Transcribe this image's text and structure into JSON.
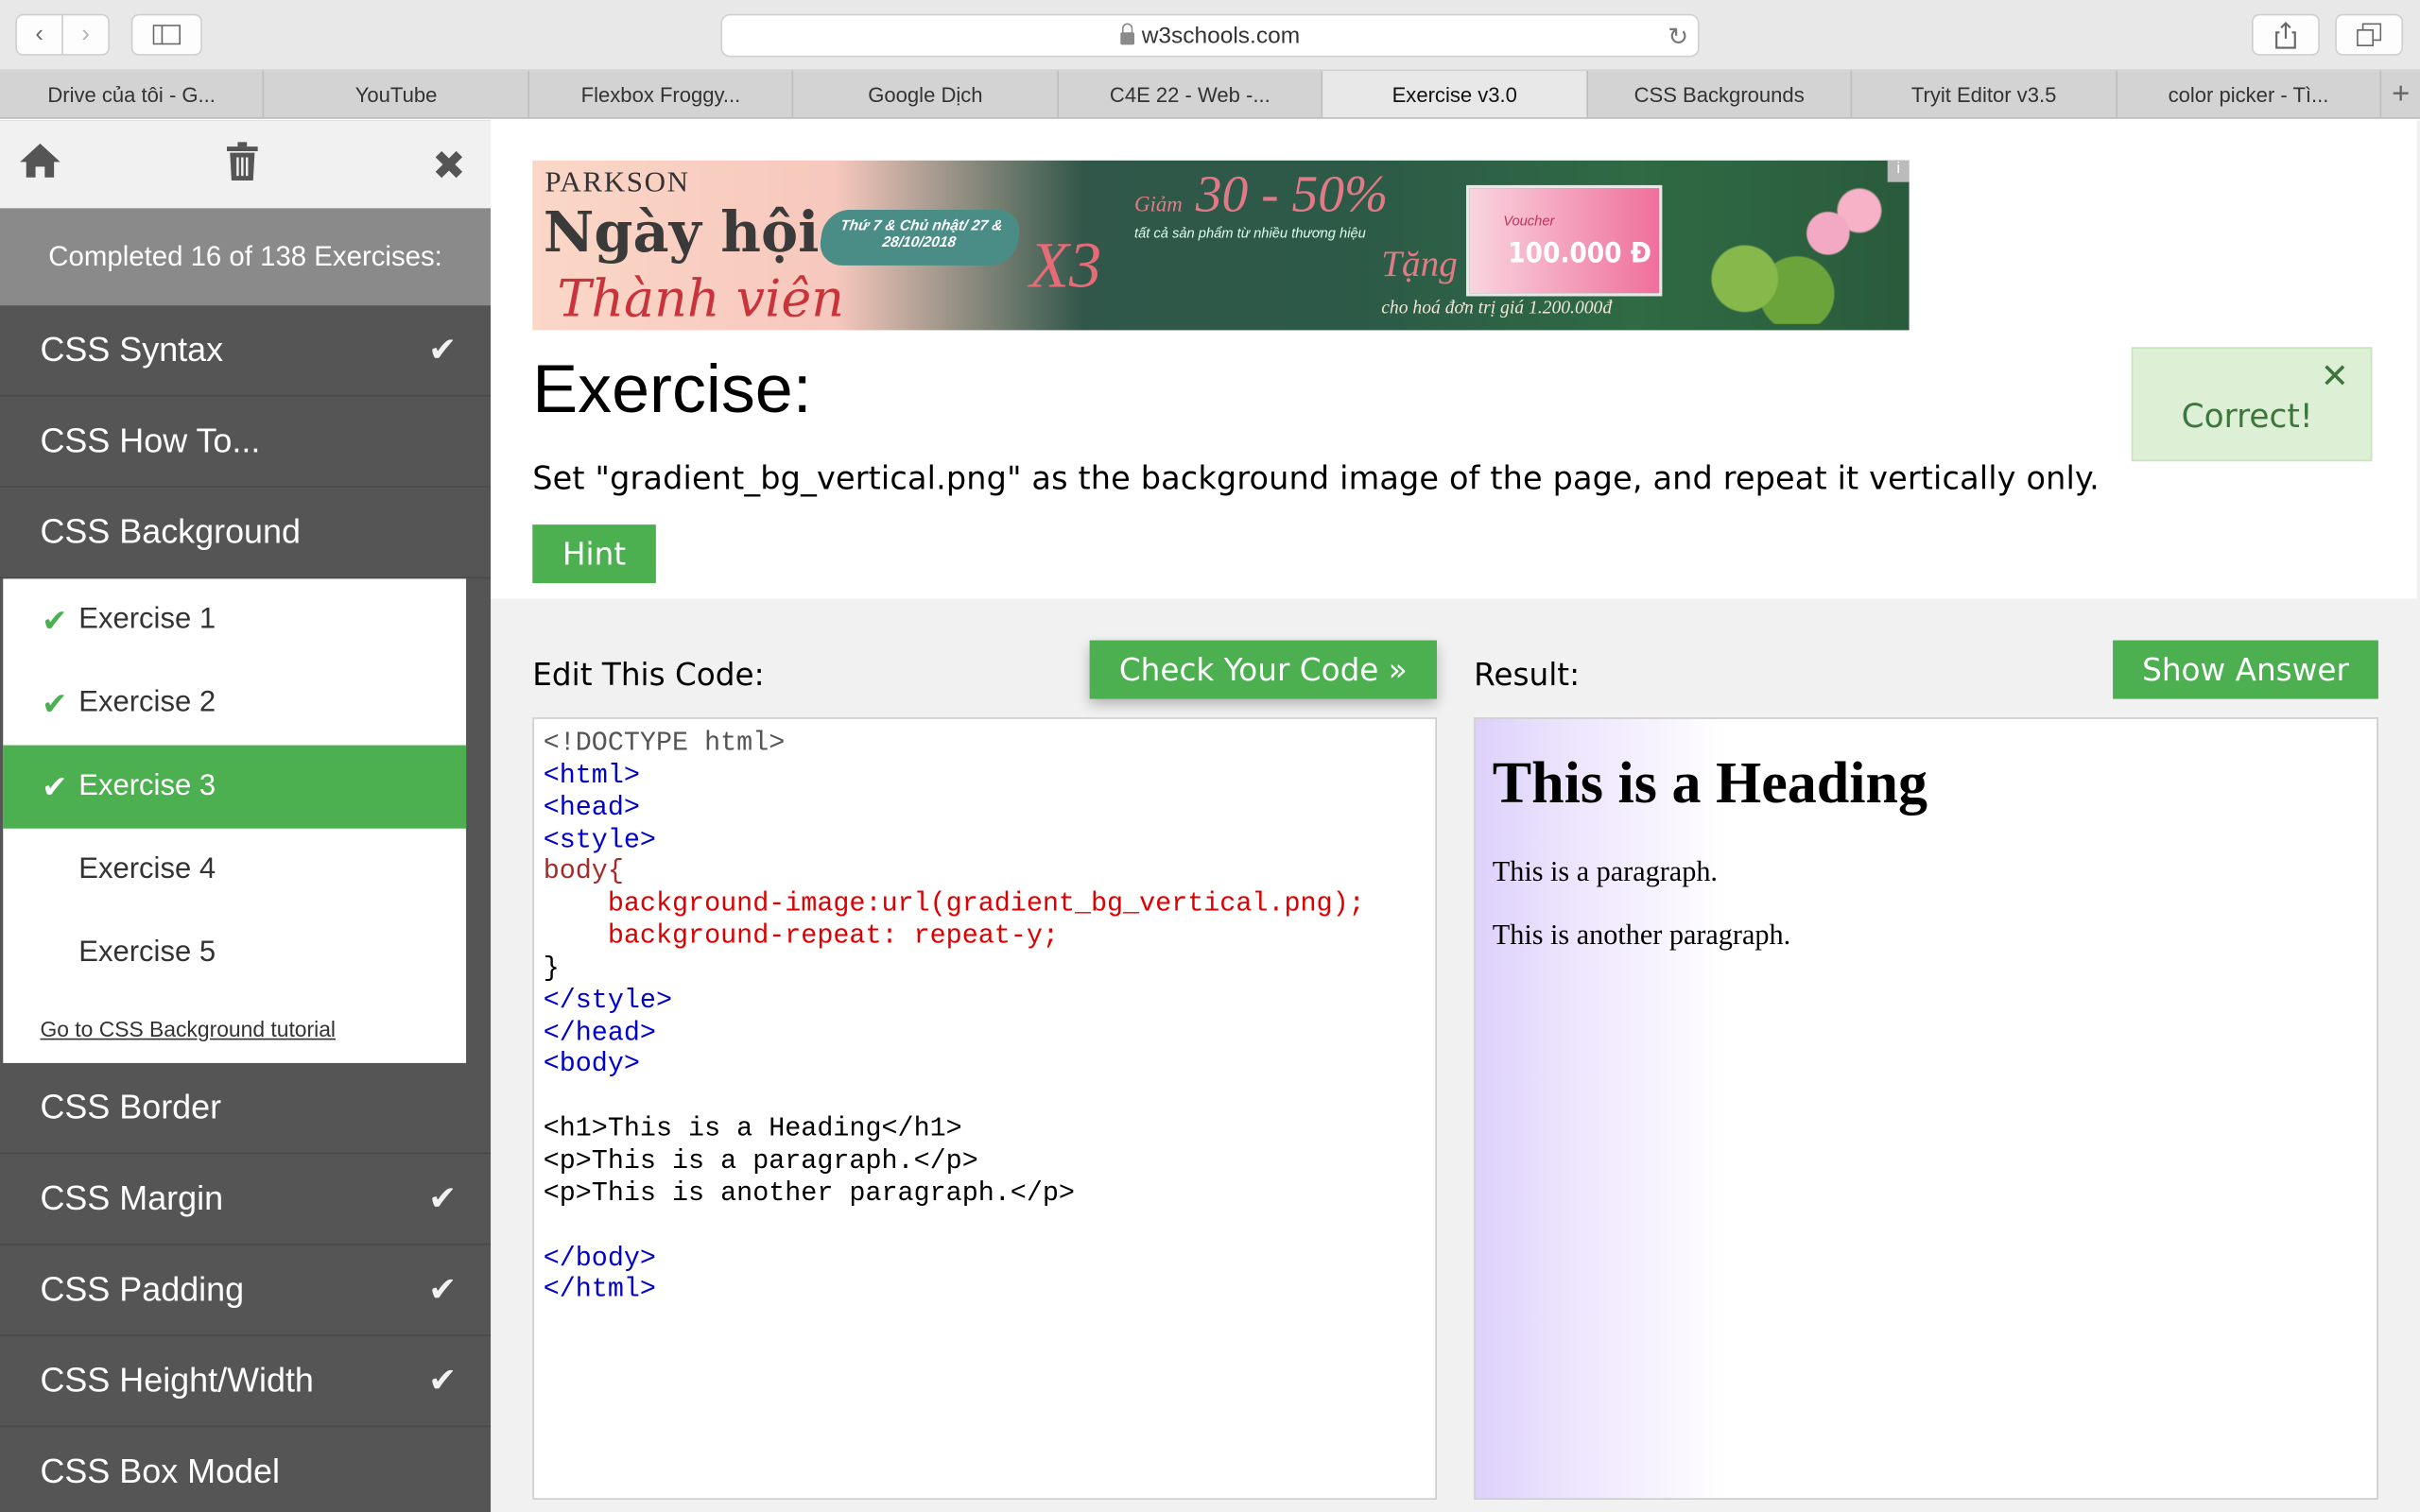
{
  "browser": {
    "url": "w3schools.com",
    "tabs": [
      "Drive của tôi - G...",
      "YouTube",
      "Flexbox Froggy...",
      "Google Dịch",
      "C4E 22 - Web -...",
      "Exercise v3.0",
      "CSS Backgrounds",
      "Tryit Editor v3.5",
      "color picker - Tì..."
    ],
    "active_tab": "Exercise v3.0"
  },
  "sidebar": {
    "completed": "Completed 16 of 138 Exercises:",
    "chapters_before": [
      {
        "label": "CSS Syntax",
        "checked": true
      },
      {
        "label": "CSS How To...",
        "checked": false
      },
      {
        "label": "CSS Background",
        "checked": false
      }
    ],
    "exercises": [
      {
        "label": "Exercise 1",
        "checked": true
      },
      {
        "label": "Exercise 2",
        "checked": true
      },
      {
        "label": "Exercise 3",
        "checked": true
      },
      {
        "label": "Exercise 4",
        "checked": false
      },
      {
        "label": "Exercise 5",
        "checked": false
      }
    ],
    "tutorial_link": "Go to CSS Background tutorial",
    "chapters_after": [
      {
        "label": "CSS Border",
        "checked": false
      },
      {
        "label": "CSS Margin",
        "checked": true
      },
      {
        "label": "CSS Padding",
        "checked": true
      },
      {
        "label": "CSS Height/Width",
        "checked": true
      },
      {
        "label": "CSS Box Model",
        "checked": false
      }
    ]
  },
  "ad": {
    "brand": "PARKSON",
    "line1": "Ngày hội",
    "line2": "Thành viên",
    "date": "Thứ 7 & Chủ nhật/ 27 & 28/10/2018",
    "x3": "X3",
    "percent": "30 - 50%",
    "percent_prefix": "Giảm",
    "percent_sub": "tất cả sản phẩm từ nhiều thương hiệu",
    "gift": "Tặng",
    "condition": "cho hoá đơn trị giá 1.200.000đ",
    "voucher_text": "Voucher",
    "voucher_amount": "100.000 Đ",
    "info": "i"
  },
  "exercise": {
    "title": "Exercise:",
    "description": "Set \"gradient_bg_vertical.png\" as the background image of the page, and repeat it vertically only.",
    "hint_label": "Hint",
    "correct_label": "Correct!",
    "close_glyph": "✕"
  },
  "editor": {
    "label": "Edit This Code:",
    "check_label": "Check Your Code »",
    "lines": [
      "<!DOCTYPE html>",
      "<html>",
      "<head>",
      "<style>",
      "body{",
      "    background-image:url(gradient_bg_vertical.png);",
      "    background-repeat: repeat-y;",
      "}",
      "</style>",
      "</head>",
      "<body>",
      "",
      "<h1>This is a Heading</h1>",
      "<p>This is a paragraph.</p>",
      "<p>This is another paragraph.</p>",
      "",
      "</body>",
      "</html>"
    ]
  },
  "result": {
    "label": "Result:",
    "show_answer_label": "Show Answer",
    "heading": "This is a Heading",
    "paragraph1": "This is a paragraph.",
    "paragraph2": "This is another paragraph."
  },
  "colors": {
    "accent_green": "#4caf50",
    "sidebar_bg": "#555555",
    "correct_bg": "#ddf0d5"
  }
}
